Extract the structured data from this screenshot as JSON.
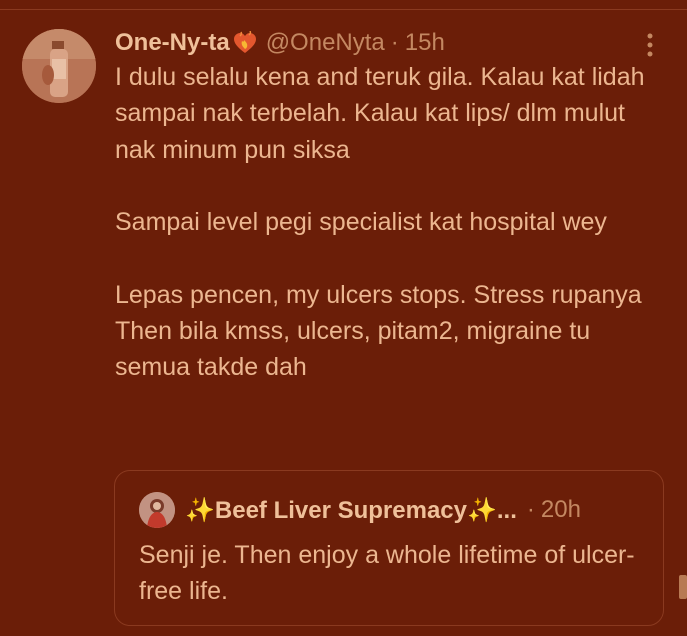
{
  "tweet": {
    "author": {
      "display_name": "One-Ny-ta",
      "handle": "@OneNyta"
    },
    "separator": "·",
    "time": "15h",
    "text": "I dulu selalu kena and teruk gila. Kalau kat lidah sampai nak terbelah. Kalau kat lips/ dlm mulut nak minum pun siksa\n\nSampai level pegi specialist kat hospital wey\n\nLepas pencen, my ulcers stops. Stress rupanya\nThen bila kmss, ulcers, pitam2, migraine tu semua takde dah",
    "icons": {
      "heart": "heart-on-fire-icon",
      "more": "more-vertical-icon"
    }
  },
  "quote": {
    "author": {
      "display_name": "✨Beef Liver Supremacy✨..."
    },
    "separator": "·",
    "time": "20h",
    "text": "Senji je. Then enjoy a whole lifetime of ulcer-free life."
  },
  "colors": {
    "background": "#6b1e08",
    "text": "#ecb690",
    "muted": "#c48862",
    "border": "#8a3a20"
  }
}
